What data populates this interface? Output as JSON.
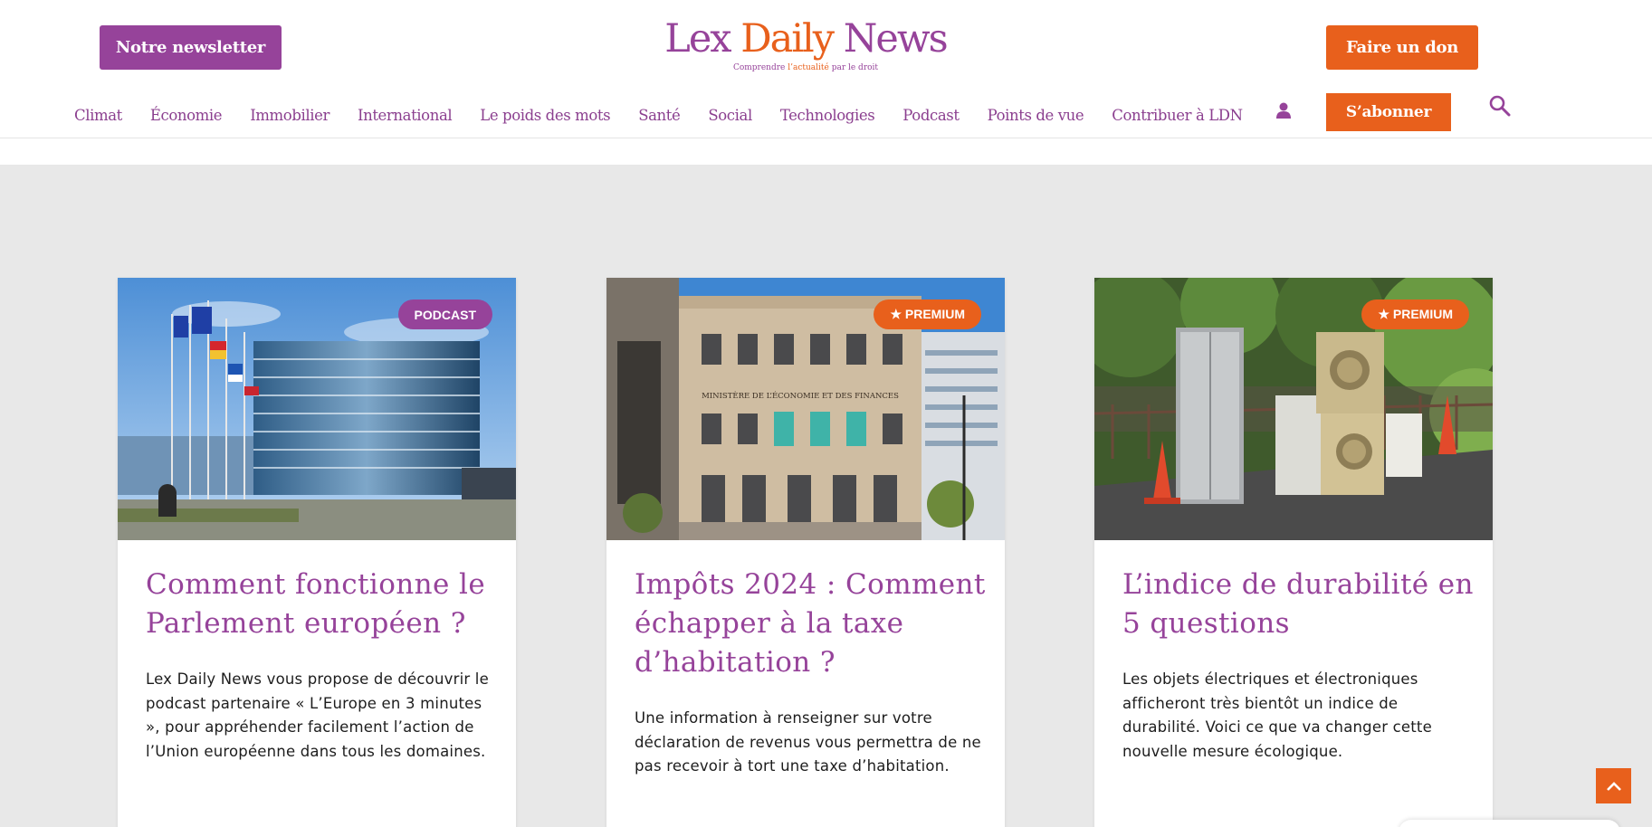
{
  "header": {
    "newsletter_label": "Notre newsletter",
    "donate_label": "Faire un don",
    "subscribe_label": "S’abonner",
    "logo": {
      "part1": "Lex ",
      "part2": "Daily",
      "part3": " News",
      "tagline_1": "Comprendre ",
      "tagline_2": "l’actualité",
      "tagline_3": " par le droit"
    },
    "nav": [
      "Climat",
      "Économie",
      "Immobilier",
      "International",
      "Le poids des mots",
      "Santé",
      "Social",
      "Technologies",
      "Podcast",
      "Points de vue",
      "Contribuer à LDN"
    ]
  },
  "colors": {
    "purple": "#96439a",
    "orange": "#e8601c",
    "background": "#e8e8e8"
  },
  "cards": [
    {
      "badge": "PODCAST",
      "title": "Comment fonctionne le Parlement européen ?",
      "excerpt": "Lex Daily News vous propose de découvrir le podcast partenaire « L’Europe en 3 minutes », pour appréhender facilement l’action de l’Union européenne dans tous les domaines."
    },
    {
      "badge": "★ PREMIUM",
      "title": "Impôts 2024 : Comment échapper à la taxe d’habitation ?",
      "excerpt": "Une information à renseigner sur votre déclaration de revenus vous permettra de ne pas recevoir à tort une taxe d’habitation."
    },
    {
      "badge": "★ PREMIUM",
      "title": "L’indice de durabilité en 5 questions",
      "excerpt": "Les objets électriques et électroniques afficheront très bientôt un indice de durabilité. Voici ce que va changer cette nouvelle mesure écologique."
    }
  ],
  "images": {
    "ministry_sign": "MINISTÈRE DE L’ÉCONOMIE ET DES FINANCES"
  }
}
